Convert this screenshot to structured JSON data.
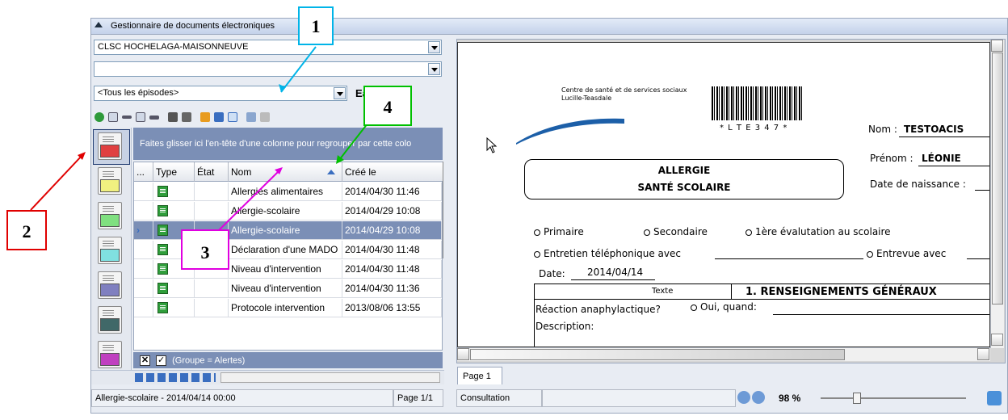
{
  "window": {
    "title": "Gestionnaire de documents électroniques"
  },
  "filters": {
    "organization": "CLSC HOCHELAGA-MAISONNEUVE",
    "second": "",
    "episodes": "<Tous les épisodes>",
    "episode_extra": "Ea"
  },
  "group_hint": "Faites glisser ici l'en-tête d'une colonne pour regrouper par cette colo",
  "grid": {
    "columns": [
      "...",
      "Type",
      "État",
      "Nom",
      "Créé le"
    ],
    "rows": [
      {
        "name": "Allergies alimentaires",
        "created": "2014/04/30 11:46",
        "selected": false
      },
      {
        "name": "Allergie-scolaire",
        "created": "2014/04/29 10:08",
        "selected": false
      },
      {
        "name": "Allergie-scolaire",
        "created": "2014/04/29 10:08",
        "selected": true
      },
      {
        "name": "Déclaration d'une MADO",
        "created": "2014/04/30 11:48",
        "selected": false
      },
      {
        "name": "Niveau d'intervention",
        "created": "2014/04/30 11:48",
        "selected": false
      },
      {
        "name": "Niveau d'intervention",
        "created": "2014/04/30 11:36",
        "selected": false
      },
      {
        "name": "Protocole intervention",
        "created": "2013/08/06 13:55",
        "selected": false
      }
    ],
    "row_marker": "›"
  },
  "filterbar": {
    "check": "✓",
    "close": "✕",
    "text": "(Groupe  = Alertes)"
  },
  "status": {
    "doc": "Allergie-scolaire - 2014/04/14 00:00",
    "page": "Page 1/1",
    "mode": "Consultation",
    "zoom": "98 %"
  },
  "viewer_tab": "Page 1",
  "document": {
    "org_line1": "Centre de santé et de services sociaux",
    "org_line2": "Lucille-Teasdale",
    "barcode_text": "* L T E 3 4 7 *",
    "nom_label": "Nom :",
    "nom_value": "TESTOACIS",
    "prenom_label": "Prénom :",
    "prenom_value": "LÉONIE",
    "dob_label": "Date de naissance :",
    "box_line1": "ALLERGIE",
    "box_line2": "SANTÉ SCOLAIRE",
    "opt_primaire": "Primaire",
    "opt_secondaire": "Secondaire",
    "opt_premiere": "1ère évalutation au scolaire",
    "opt_entretien": "Entretien téléphonique avec",
    "opt_entrevue": "Entrevue avec",
    "date_label": "Date:",
    "date_value": "2014/04/14",
    "texte_label": "Texte",
    "section_title": "1. RENSEIGNEMENTS GÉNÉRAUX",
    "reaction": "Réaction anaphylactique?",
    "oui_quand": "Oui, quand:",
    "description": "Description:"
  },
  "callouts": [
    "1",
    "2",
    "3",
    "4"
  ],
  "colors": {
    "callout1": "#00b4e8",
    "callout2": "#e00000",
    "callout3": "#e000e0",
    "callout4": "#00c000",
    "selection": "#7b8fb6",
    "doc_icons": [
      "#e04040",
      "#f0f080",
      "#80e080",
      "#80e0e0",
      "#8080c0",
      "#406868",
      "#c040c0"
    ]
  }
}
